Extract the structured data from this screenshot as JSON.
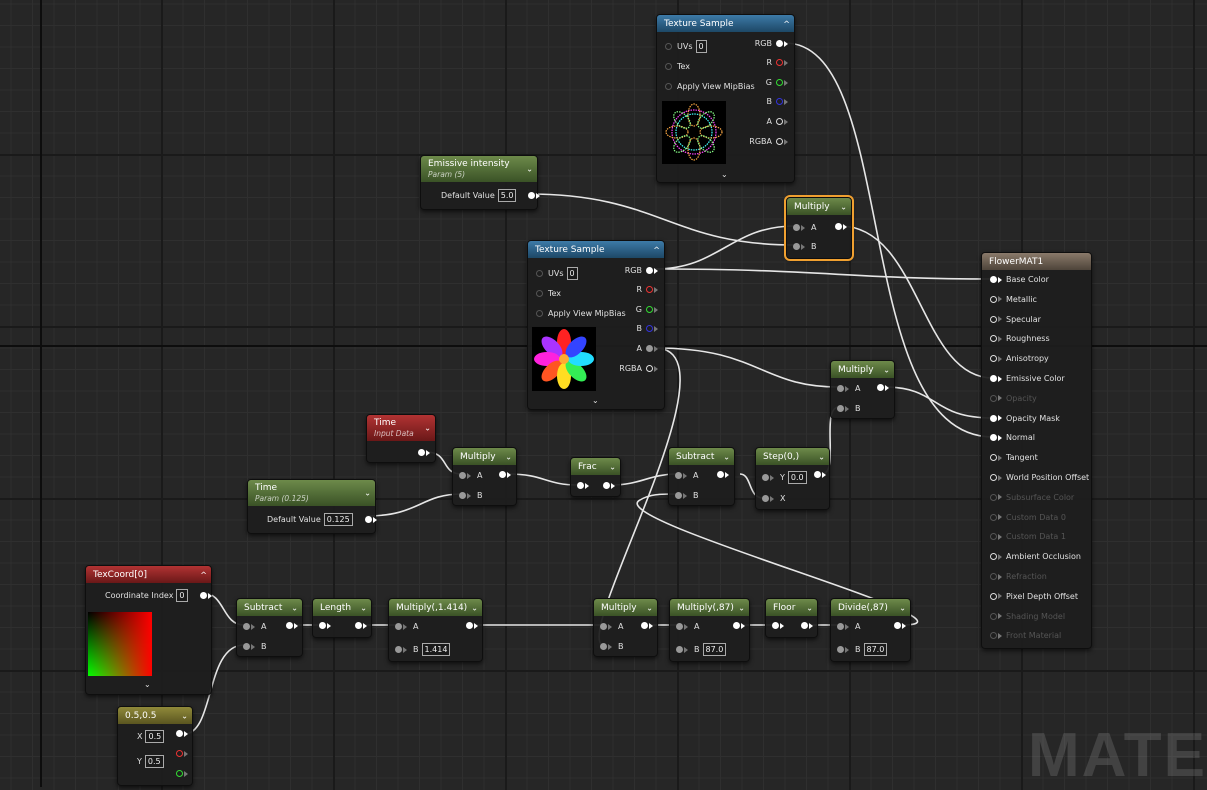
{
  "watermark": "MATE",
  "tex_top": {
    "title": "Texture Sample",
    "uvs": "UVs",
    "uvs_val": "0",
    "tex": "Tex",
    "mip": "Apply View MipBias",
    "rgb": "RGB",
    "r": "R",
    "g": "G",
    "b": "B",
    "a": "A",
    "rgba": "RGBA"
  },
  "tex_mid": {
    "title": "Texture Sample",
    "uvs": "UVs",
    "uvs_val": "0",
    "tex": "Tex",
    "mip": "Apply View MipBias",
    "rgb": "RGB",
    "r": "R",
    "g": "G",
    "b": "B",
    "a": "A",
    "rgba": "RGBA"
  },
  "emissive": {
    "title": "Emissive intensity",
    "sub": "Param (5)",
    "label": "Default Value",
    "value": "5.0"
  },
  "multiply_sel": {
    "title": "Multiply",
    "a": "A",
    "b": "B"
  },
  "multiply_right": {
    "title": "Multiply",
    "a": "A",
    "b": "B"
  },
  "time_input": {
    "title": "Time",
    "sub": "Input Data"
  },
  "time_param": {
    "title": "Time",
    "sub": "Param (0.125)",
    "label": "Default Value",
    "value": "0.125"
  },
  "multiply_time": {
    "title": "Multiply",
    "a": "A",
    "b": "B"
  },
  "frac": {
    "title": "Frac"
  },
  "subtract_mid": {
    "title": "Subtract",
    "a": "A",
    "b": "B"
  },
  "step": {
    "title": "Step(0,)",
    "y": "Y",
    "y_val": "0.0",
    "x": "X"
  },
  "texcoord": {
    "title": "TexCoord[0]",
    "label": "Coordinate Index",
    "value": "0"
  },
  "const2": {
    "title": "0.5,0.5",
    "x": "X",
    "x_val": "0.5",
    "y": "Y",
    "y_val": "0.5"
  },
  "subtract_low": {
    "title": "Subtract",
    "a": "A",
    "b": "B"
  },
  "length": {
    "title": "Length"
  },
  "mul_1414": {
    "title": "Multiply(,1.414)",
    "a": "A",
    "b": "B",
    "b_val": "1.414"
  },
  "multiply_low": {
    "title": "Multiply",
    "a": "A",
    "b": "B"
  },
  "mul_87": {
    "title": "Multiply(,87)",
    "a": "A",
    "b": "B",
    "b_val": "87.0"
  },
  "floor": {
    "title": "Floor"
  },
  "divide": {
    "title": "Divide(,87)",
    "a": "A",
    "b": "B",
    "b_val": "87.0"
  },
  "material": {
    "title": "FlowerMAT1",
    "inputs": [
      {
        "label": "Base Color",
        "state": "on"
      },
      {
        "label": "Metallic",
        "state": "hol"
      },
      {
        "label": "Specular",
        "state": "hol"
      },
      {
        "label": "Roughness",
        "state": "hol"
      },
      {
        "label": "Anisotropy",
        "state": "hol"
      },
      {
        "label": "Emissive Color",
        "state": "on"
      },
      {
        "label": "Opacity",
        "state": "dim"
      },
      {
        "label": "Opacity Mask",
        "state": "on"
      },
      {
        "label": "Normal",
        "state": "on"
      },
      {
        "label": "Tangent",
        "state": "hol"
      },
      {
        "label": "World Position Offset",
        "state": "hol"
      },
      {
        "label": "Subsurface Color",
        "state": "dim"
      },
      {
        "label": "Custom Data 0",
        "state": "dim"
      },
      {
        "label": "Custom Data 1",
        "state": "dim"
      },
      {
        "label": "Ambient Occlusion",
        "state": "hol"
      },
      {
        "label": "Refraction",
        "state": "dim"
      },
      {
        "label": "Pixel Depth Offset",
        "state": "hol"
      },
      {
        "label": "Shading Model",
        "state": "dim"
      },
      {
        "label": "Front Material",
        "state": "dim"
      }
    ]
  },
  "colors": {
    "header_green": "#3a5226",
    "header_blue": "#1d4866",
    "header_red": "#6a1818",
    "header_yellow": "#5a5520",
    "selection": "#f0a030"
  }
}
